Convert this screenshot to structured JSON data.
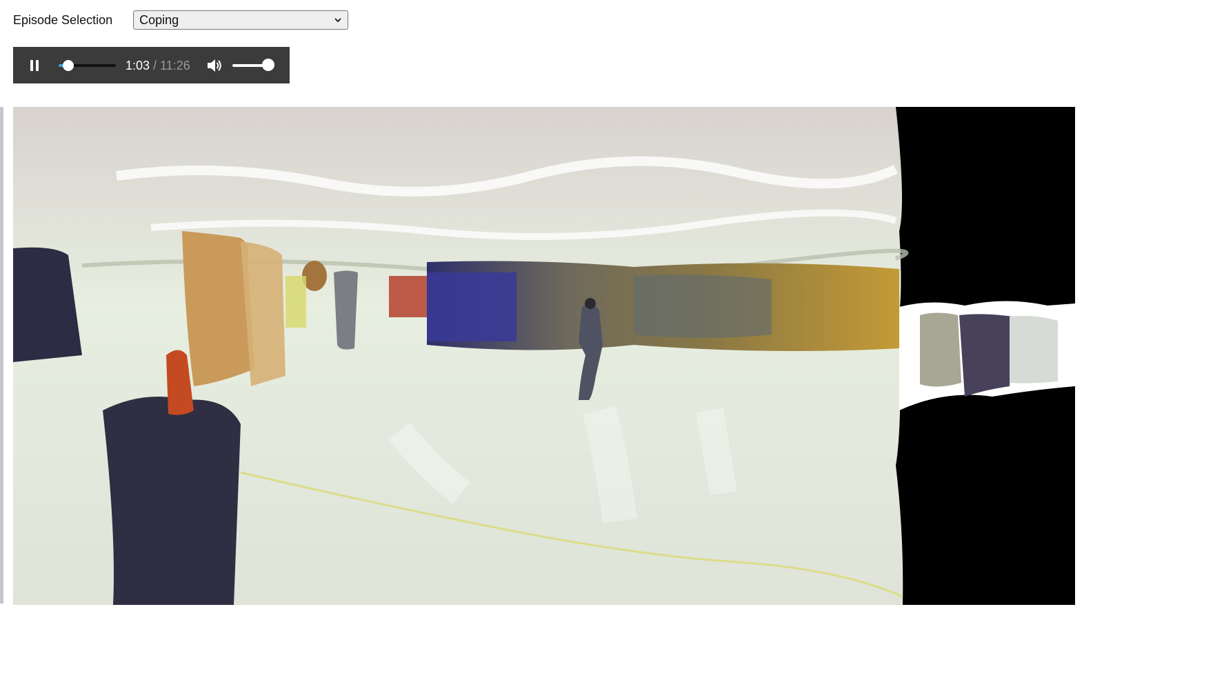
{
  "episode": {
    "label": "Episode Selection",
    "selected": "Coping"
  },
  "player": {
    "state": "playing",
    "current_time": "1:03",
    "separator": "/",
    "duration": "11:26",
    "progress_fraction": 0.092,
    "volume_fraction": 1.0
  },
  "icons": {
    "play_pause": "pause-icon",
    "volume": "volume-icon",
    "dropdown": "chevron-down-icon"
  },
  "colors": {
    "player_bg": "#3b3b3b",
    "seek_accent": "#29a8e0"
  }
}
